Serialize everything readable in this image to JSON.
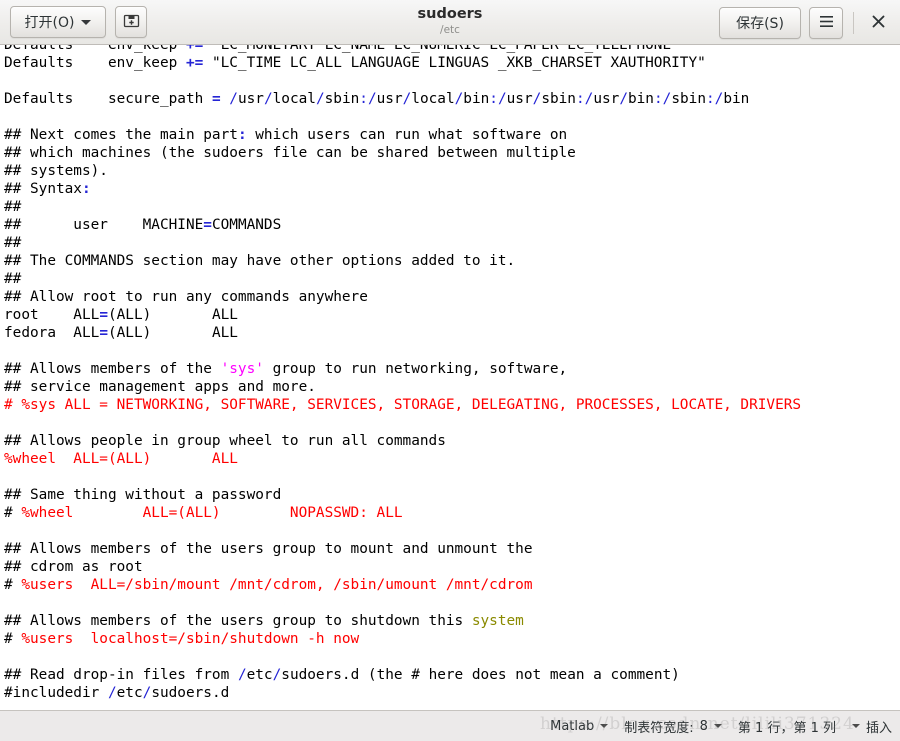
{
  "window": {
    "title": "sudoers",
    "subtitle": "/etc",
    "open_button": "打开(O)",
    "save_button": "保存(S)",
    "new_icon": "new-document-icon",
    "menu_icon": "hamburger-menu-icon",
    "close_icon": "close-icon",
    "caret_icon": "chevron-down-icon"
  },
  "statusbar": {
    "language": "Matlab",
    "tab_width_label": "制表符宽度:",
    "tab_width_value": "8",
    "position": "第 1 行，第 1 列",
    "insert_mode": "插入",
    "watermark": "https://blog.csdn.net/lilili371324"
  },
  "editor": {
    "lines": [
      [
        {
          "t": "Defaults    env_keep ",
          "c": ""
        },
        {
          "t": "+=",
          "c": "op"
        },
        {
          "t": " \"LC_MONETARY LC_NAME LC_NUMERIC LC_PAPER LC_TELEPHONE\"",
          "c": ""
        }
      ],
      [
        {
          "t": "Defaults    env_keep ",
          "c": ""
        },
        {
          "t": "+=",
          "c": "op"
        },
        {
          "t": " \"LC_TIME LC_ALL LANGUAGE LINGUAS _XKB_CHARSET XAUTHORITY\"",
          "c": ""
        }
      ],
      [
        {
          "t": "",
          "c": ""
        }
      ],
      [
        {
          "t": "Defaults    secure_path ",
          "c": ""
        },
        {
          "t": "=",
          "c": "op"
        },
        {
          "t": " ",
          "c": ""
        },
        {
          "t": "/",
          "c": "opb"
        },
        {
          "t": "usr",
          "c": ""
        },
        {
          "t": "/",
          "c": "opb"
        },
        {
          "t": "local",
          "c": ""
        },
        {
          "t": "/",
          "c": "opb"
        },
        {
          "t": "sbin",
          "c": ""
        },
        {
          "t": ":",
          "c": "opb"
        },
        {
          "t": "/",
          "c": "opb"
        },
        {
          "t": "usr",
          "c": ""
        },
        {
          "t": "/",
          "c": "opb"
        },
        {
          "t": "local",
          "c": ""
        },
        {
          "t": "/",
          "c": "opb"
        },
        {
          "t": "bin",
          "c": ""
        },
        {
          "t": ":",
          "c": "opb"
        },
        {
          "t": "/",
          "c": "opb"
        },
        {
          "t": "usr",
          "c": ""
        },
        {
          "t": "/",
          "c": "opb"
        },
        {
          "t": "sbin",
          "c": ""
        },
        {
          "t": ":",
          "c": "opb"
        },
        {
          "t": "/",
          "c": "opb"
        },
        {
          "t": "usr",
          "c": ""
        },
        {
          "t": "/",
          "c": "opb"
        },
        {
          "t": "bin",
          "c": ""
        },
        {
          "t": ":",
          "c": "opb"
        },
        {
          "t": "/",
          "c": "opb"
        },
        {
          "t": "sbin",
          "c": ""
        },
        {
          "t": ":",
          "c": "opb"
        },
        {
          "t": "/",
          "c": "opb"
        },
        {
          "t": "bin",
          "c": ""
        }
      ],
      [
        {
          "t": "",
          "c": ""
        }
      ],
      [
        {
          "t": "## Next comes the main part",
          "c": ""
        },
        {
          "t": ":",
          "c": "op"
        },
        {
          "t": " which users can run what software on",
          "c": ""
        }
      ],
      [
        {
          "t": "## which machines (the sudoers file can be shared between multiple",
          "c": ""
        }
      ],
      [
        {
          "t": "## systems).",
          "c": ""
        }
      ],
      [
        {
          "t": "## Syntax",
          "c": ""
        },
        {
          "t": ":",
          "c": "op"
        }
      ],
      [
        {
          "t": "##",
          "c": ""
        }
      ],
      [
        {
          "t": "##      user    MACHINE",
          "c": ""
        },
        {
          "t": "=",
          "c": "op"
        },
        {
          "t": "COMMANDS",
          "c": ""
        }
      ],
      [
        {
          "t": "##",
          "c": ""
        }
      ],
      [
        {
          "t": "## The COMMANDS section may have other options added to it.",
          "c": ""
        }
      ],
      [
        {
          "t": "##",
          "c": ""
        }
      ],
      [
        {
          "t": "## Allow root to run any commands anywhere",
          "c": ""
        }
      ],
      [
        {
          "t": "root    ALL",
          "c": ""
        },
        {
          "t": "=",
          "c": "op"
        },
        {
          "t": "(ALL)       ALL",
          "c": ""
        }
      ],
      [
        {
          "t": "fedora  ALL",
          "c": ""
        },
        {
          "t": "=",
          "c": "op"
        },
        {
          "t": "(ALL)       ALL",
          "c": ""
        }
      ],
      [
        {
          "t": "",
          "c": ""
        }
      ],
      [
        {
          "t": "## Allows members of the ",
          "c": ""
        },
        {
          "t": "'sys'",
          "c": "mag"
        },
        {
          "t": " group to run networking, software,",
          "c": ""
        }
      ],
      [
        {
          "t": "## service management apps and more.",
          "c": ""
        }
      ],
      [
        {
          "t": "# %sys ALL = NETWORKING, SOFTWARE, SERVICES, STORAGE, DELEGATING, PROCESSES, LOCATE, DRIVERS",
          "c": "red"
        }
      ],
      [
        {
          "t": "",
          "c": ""
        }
      ],
      [
        {
          "t": "## Allows people in group wheel to run all commands",
          "c": ""
        }
      ],
      [
        {
          "t": "%wheel  ALL=(ALL)       ALL",
          "c": "red"
        }
      ],
      [
        {
          "t": "",
          "c": ""
        }
      ],
      [
        {
          "t": "## Same thing without a password",
          "c": ""
        }
      ],
      [
        {
          "t": "# ",
          "c": ""
        },
        {
          "t": "%wheel        ALL=(ALL)        NOPASSWD: ALL",
          "c": "red"
        }
      ],
      [
        {
          "t": "",
          "c": ""
        }
      ],
      [
        {
          "t": "## Allows members of the users group to mount and unmount the",
          "c": ""
        }
      ],
      [
        {
          "t": "## cdrom as root",
          "c": ""
        }
      ],
      [
        {
          "t": "# ",
          "c": ""
        },
        {
          "t": "%users  ALL=/sbin/mount /mnt/cdrom, /sbin/umount /mnt/cdrom",
          "c": "red"
        }
      ],
      [
        {
          "t": "",
          "c": ""
        }
      ],
      [
        {
          "t": "## Allows members of the users group to shutdown this ",
          "c": ""
        },
        {
          "t": "system",
          "c": "olv"
        }
      ],
      [
        {
          "t": "# ",
          "c": ""
        },
        {
          "t": "%users  localhost=/sbin/shutdown -h now",
          "c": "red"
        }
      ],
      [
        {
          "t": "",
          "c": ""
        }
      ],
      [
        {
          "t": "## Read drop-in files from ",
          "c": ""
        },
        {
          "t": "/",
          "c": "opb"
        },
        {
          "t": "etc",
          "c": ""
        },
        {
          "t": "/",
          "c": "opb"
        },
        {
          "t": "sudoers.d (the # here does not mean a comment)",
          "c": ""
        }
      ],
      [
        {
          "t": "#includedir ",
          "c": ""
        },
        {
          "t": "/",
          "c": "opb"
        },
        {
          "t": "etc",
          "c": ""
        },
        {
          "t": "/",
          "c": "opb"
        },
        {
          "t": "sudoers.d",
          "c": ""
        }
      ]
    ]
  }
}
